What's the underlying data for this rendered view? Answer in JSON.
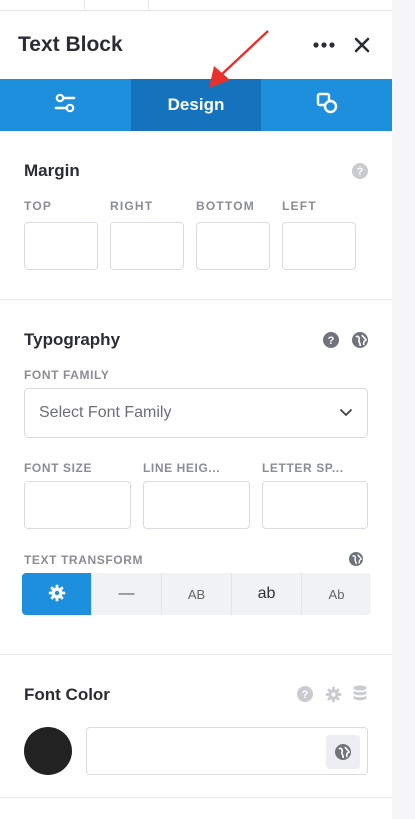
{
  "panel": {
    "title": "Text Block"
  },
  "tabs": [
    {
      "label": "",
      "icon": "sliders-icon"
    },
    {
      "label": "Design",
      "icon": ""
    },
    {
      "label": "",
      "icon": "shapes-icon"
    }
  ],
  "margin": {
    "title": "Margin",
    "fields": [
      "TOP",
      "RIGHT",
      "BOTTOM",
      "LEFT"
    ]
  },
  "typography": {
    "title": "Typography",
    "font_family_label": "FONT FAMILY",
    "font_family_placeholder": "Select Font Family",
    "font_size_label": "FONT SIZE",
    "line_height_label": "LINE HEIG...",
    "letter_spacing_label": "LETTER SP...",
    "text_transform_label": "TEXT TRANSFORM",
    "transform_options": [
      "",
      "—",
      "AB",
      "ab",
      "Ab"
    ]
  },
  "font_color": {
    "title": "Font Color",
    "swatch": "#222222"
  },
  "colors": {
    "accent": "#1e8fdd",
    "accent_dark": "#1573bd",
    "arrow": "#e8312a"
  }
}
